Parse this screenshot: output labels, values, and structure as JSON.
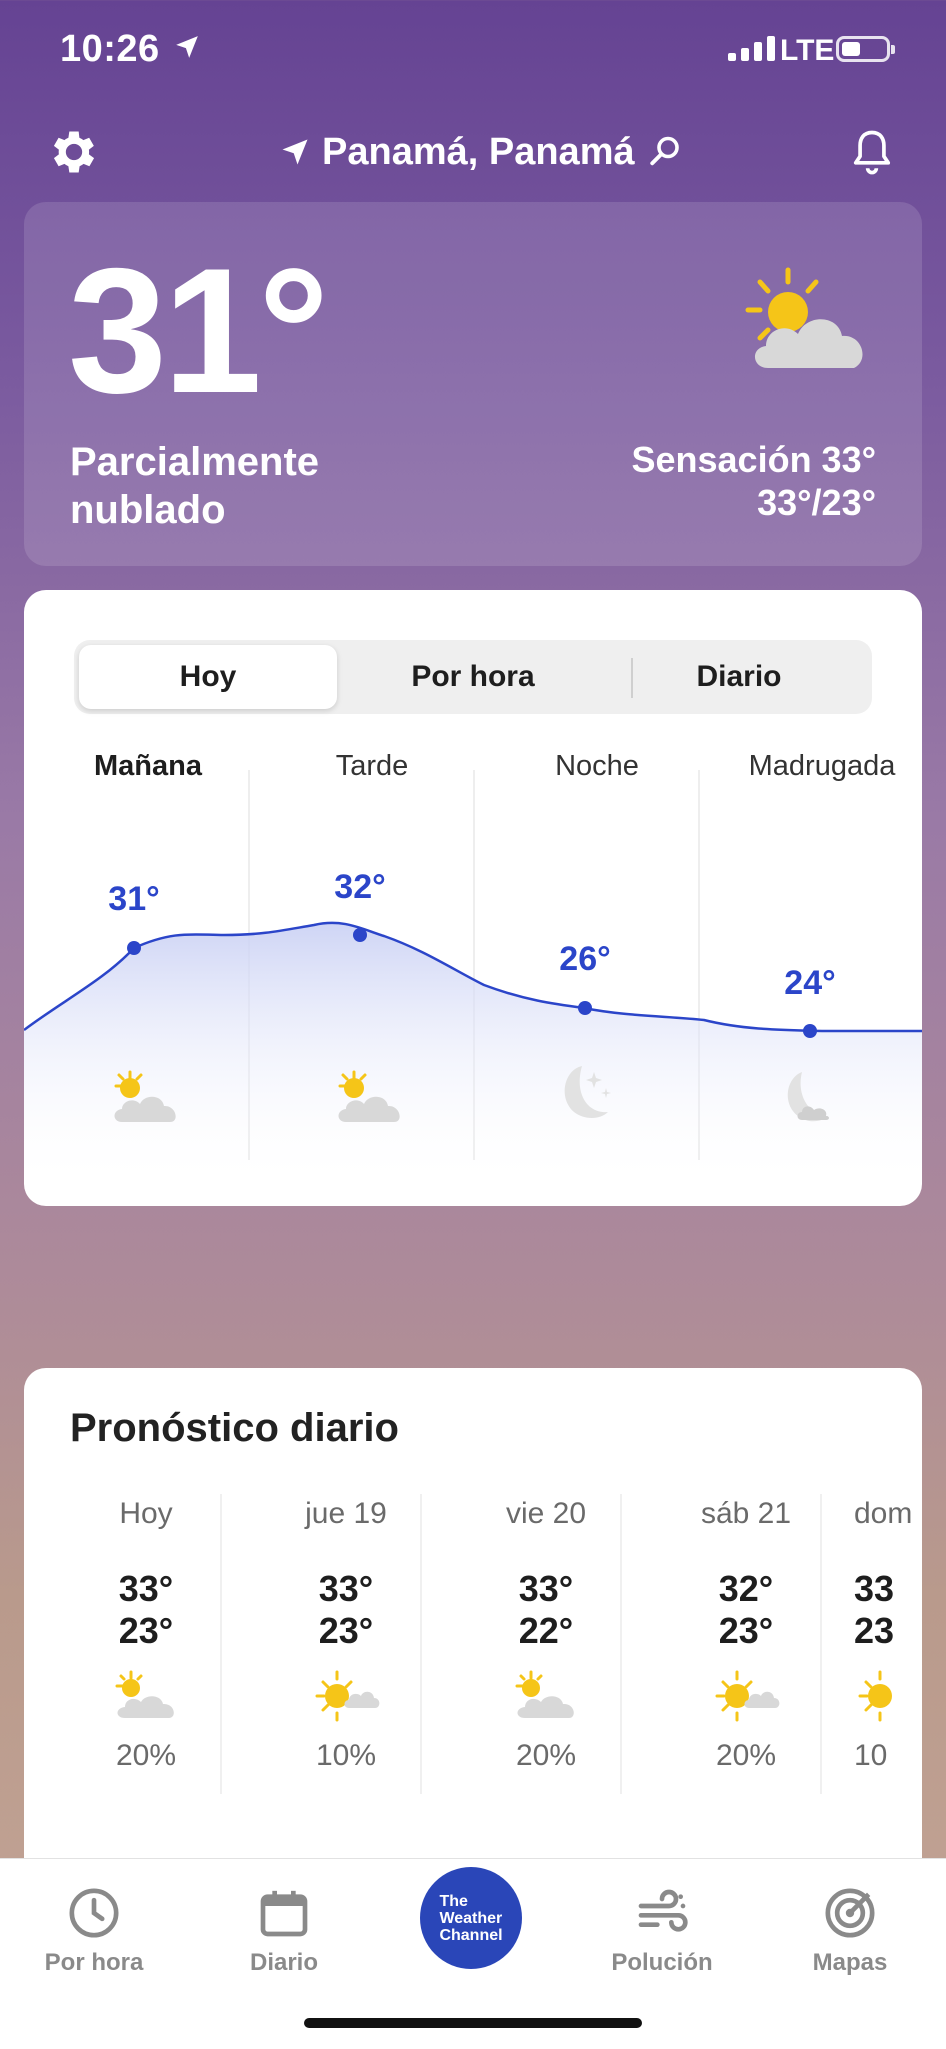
{
  "status_bar": {
    "time": "10:26",
    "network": "LTE"
  },
  "header": {
    "location": "Panamá, Panamá"
  },
  "current": {
    "temperature": "31°",
    "condition": "Parcialmente nublado",
    "feels_like": "Sensación 33°",
    "high_low": "33°/23°",
    "icon": "partly-cloudy-icon"
  },
  "today_card": {
    "tabs": [
      {
        "label": "Hoy",
        "active": true
      },
      {
        "label": "Por hora",
        "active": false
      },
      {
        "label": "Diario",
        "active": false
      }
    ],
    "periods": [
      {
        "label": "Mañana",
        "temp": "31°",
        "icon": "partly-cloudy-icon"
      },
      {
        "label": "Tarde",
        "temp": "32°",
        "icon": "partly-cloudy-icon"
      },
      {
        "label": "Noche",
        "temp": "26°",
        "icon": "clear-night-icon"
      },
      {
        "label": "Madrugada",
        "temp": "24°",
        "icon": "partly-cloudy-night-icon"
      }
    ]
  },
  "daily": {
    "title": "Pronóstico diario",
    "days": [
      {
        "name": "Hoy",
        "hi": "33°",
        "lo": "23°",
        "precip": "20%",
        "icon": "partly-cloudy-icon"
      },
      {
        "name": "jue 19",
        "hi": "33°",
        "lo": "23°",
        "precip": "10%",
        "icon": "mostly-sunny-icon"
      },
      {
        "name": "vie 20",
        "hi": "33°",
        "lo": "22°",
        "precip": "20%",
        "icon": "partly-cloudy-icon"
      },
      {
        "name": "sáb 21",
        "hi": "32°",
        "lo": "23°",
        "precip": "20%",
        "icon": "mostly-sunny-icon"
      },
      {
        "name": "dom",
        "hi": "33",
        "lo": "23",
        "precip": "10",
        "icon": "mostly-sunny-icon"
      }
    ]
  },
  "tab_bar": {
    "items": [
      {
        "label": "Por hora",
        "icon": "clock-icon"
      },
      {
        "label": "Diario",
        "icon": "calendar-icon"
      },
      {
        "label": "The Weather Channel",
        "icon": "twc-logo"
      },
      {
        "label": "Polución",
        "icon": "wind-icon"
      },
      {
        "label": "Mapas",
        "icon": "radar-icon"
      }
    ],
    "logo_lines": [
      "The",
      "Weather",
      "Channel"
    ]
  },
  "colors": {
    "accent": "#2b45c9",
    "header_bg": "#654393"
  }
}
